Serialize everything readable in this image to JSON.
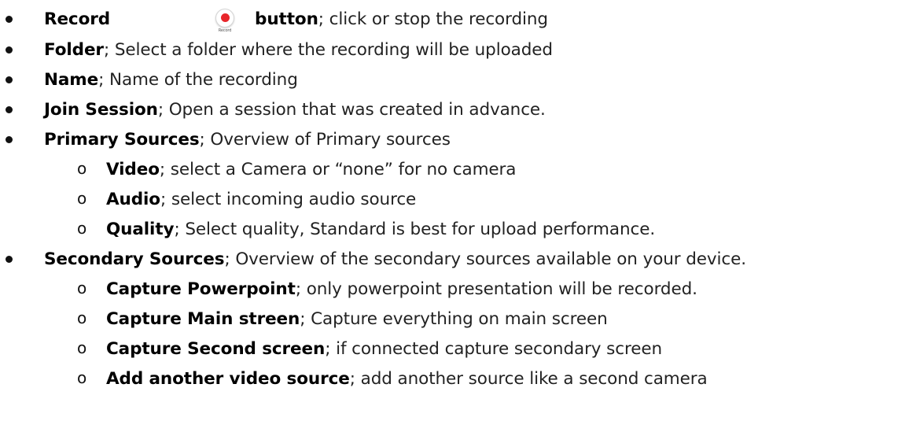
{
  "colors": {
    "text": "#1a1a1a",
    "record_red": "#e8262b"
  },
  "items": [
    {
      "term": "Record",
      "icon_name": "record-icon",
      "icon_caption": "Record",
      "term2": "button",
      "desc": " ; click or stop the recording"
    },
    {
      "term": "Folder",
      "desc": "; Select a folder where the recording will be uploaded"
    },
    {
      "term": "Name",
      "desc": "; Name of the recording"
    },
    {
      "term": "Join Session",
      "desc": "; Open a session that was created in advance."
    },
    {
      "term": "Primary Sources",
      "desc": "; Overview of Primary sources"
    },
    {
      "term": "Video",
      "desc": "; select a Camera or “none” for no camera"
    },
    {
      "term": "Audio",
      "desc": "; select incoming audio source"
    },
    {
      "term": "Quality",
      "desc": "; Select quality, Standard is best for upload performance."
    },
    {
      "term": "Secondary Sources",
      "desc": "; Overview of the secondary sources available on your device."
    },
    {
      "term": "Capture Powerpoint",
      "desc": "; only powerpoint presentation will be recorded."
    },
    {
      "term": "Capture Main streen",
      "desc": "; Capture everything on main screen"
    },
    {
      "term": "Capture Second screen",
      "desc": "; if connected capture secondary screen"
    },
    {
      "term": "Add another video source",
      "desc": " ; add another source like a second camera"
    }
  ],
  "markers": {
    "bullet": "•",
    "sub_bullet": "o"
  }
}
